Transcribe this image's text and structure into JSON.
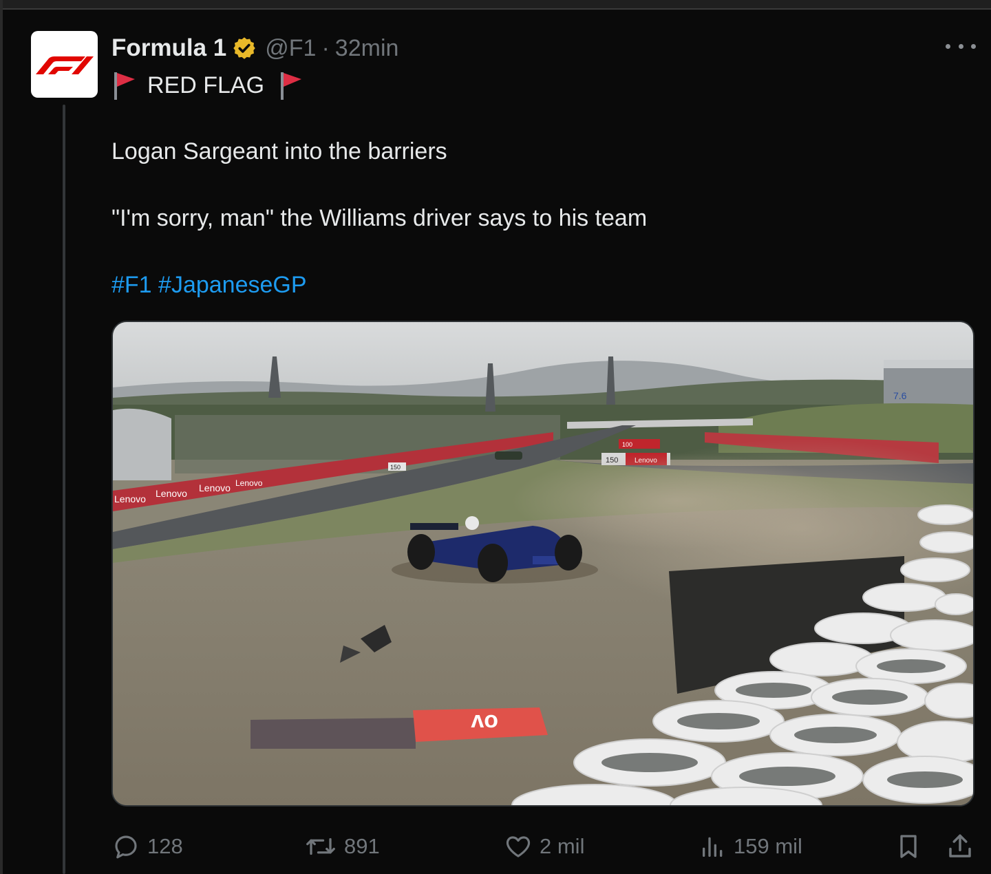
{
  "tweet": {
    "author": {
      "display_name": "Formula 1",
      "handle": "@F1",
      "separator": "·",
      "time": "32min",
      "avatar_text": "F1",
      "verified_color": "#e8b829",
      "brand_color": "#e10600"
    },
    "lines": {
      "red_flag": "RED FLAG",
      "body1": "Logan Sargeant into the barriers",
      "body2": "\"I'm sorry, man\" the Williams driver says to his team",
      "hashtags": [
        "#F1",
        "#JapaneseGP"
      ]
    },
    "media": {
      "visible_signage": [
        "Lenovo",
        "150",
        "100",
        "7.6"
      ]
    },
    "stats": {
      "replies": "128",
      "retweets": "891",
      "likes": "2 mil",
      "views": "159 mil"
    }
  },
  "colors": {
    "background": "#0a0a0a",
    "text": "#e7e9ea",
    "muted": "#71767b",
    "link": "#1d9bf0"
  },
  "icons": {
    "more": "more-icon",
    "reply": "reply-icon",
    "retweet": "retweet-icon",
    "like": "heart-icon",
    "views": "views-icon",
    "bookmark": "bookmark-icon",
    "share": "share-icon",
    "flag": "red-flag-emoji",
    "verified": "verified-badge-icon"
  }
}
